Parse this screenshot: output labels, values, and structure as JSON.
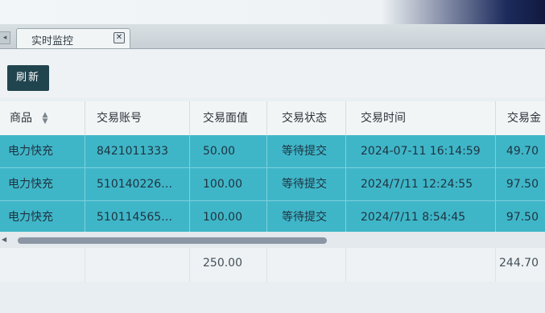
{
  "tab": {
    "label": "实时监控",
    "close_glyph": "✕",
    "scroll_glyph": "◂"
  },
  "toolbar": {
    "refresh_label": "刷新"
  },
  "table": {
    "columns": [
      "商品",
      "交易账号",
      "交易面值",
      "交易状态",
      "交易时间",
      "交易金"
    ],
    "rows": [
      [
        "电力快充",
        "8421011333",
        "50.00",
        "等待提交",
        "2024-07-11 16:14:59",
        "49.70"
      ],
      [
        "电力快充",
        "510140226…",
        "100.00",
        "等待提交",
        "2024/7/11 12:24:55",
        "97.50"
      ],
      [
        "电力快充",
        "510114565…",
        "100.00",
        "等待提交",
        "2024/7/11 8:54:45",
        "97.50"
      ]
    ],
    "footer": {
      "face_value_total": "250.00",
      "amount_total": "244.70"
    }
  },
  "colors": {
    "selected_row": "#3fb6c8",
    "refresh_button": "#21454f"
  },
  "icons": {
    "sort": "sort-icon",
    "close": "close-icon"
  }
}
